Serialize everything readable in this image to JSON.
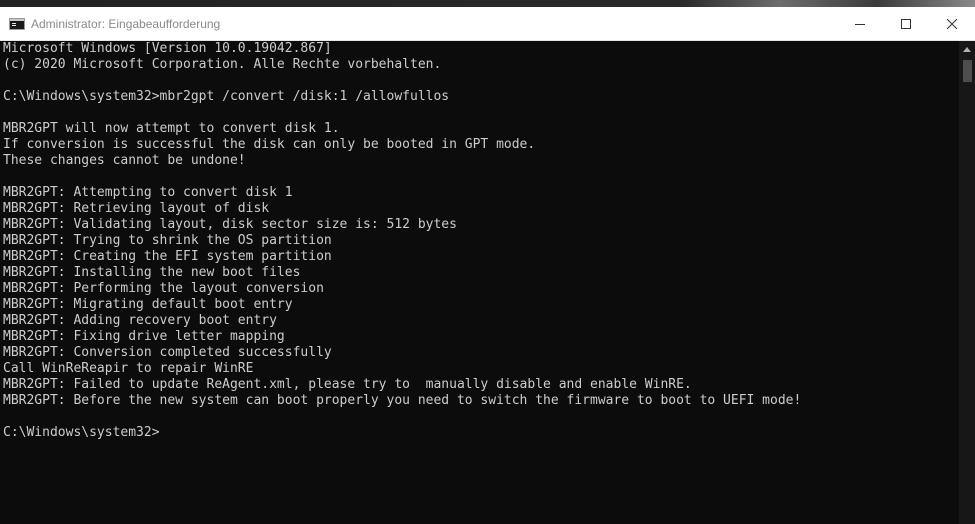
{
  "window": {
    "title": "Administrator: Eingabeaufforderung",
    "icon": "cmd-icon",
    "controls": [
      "minimize-icon",
      "maximize-icon",
      "close-icon"
    ]
  },
  "console": {
    "lines": [
      "Microsoft Windows [Version 10.0.19042.867]",
      "(c) 2020 Microsoft Corporation. Alle Rechte vorbehalten.",
      "",
      "C:\\Windows\\system32>mbr2gpt /convert /disk:1 /allowfullos",
      "",
      "MBR2GPT will now attempt to convert disk 1.",
      "If conversion is successful the disk can only be booted in GPT mode.",
      "These changes cannot be undone!",
      "",
      "MBR2GPT: Attempting to convert disk 1",
      "MBR2GPT: Retrieving layout of disk",
      "MBR2GPT: Validating layout, disk sector size is: 512 bytes",
      "MBR2GPT: Trying to shrink the OS partition",
      "MBR2GPT: Creating the EFI system partition",
      "MBR2GPT: Installing the new boot files",
      "MBR2GPT: Performing the layout conversion",
      "MBR2GPT: Migrating default boot entry",
      "MBR2GPT: Adding recovery boot entry",
      "MBR2GPT: Fixing drive letter mapping",
      "MBR2GPT: Conversion completed successfully",
      "Call WinReReapir to repair WinRE",
      "MBR2GPT: Failed to update ReAgent.xml, please try to  manually disable and enable WinRE.",
      "MBR2GPT: Before the new system can boot properly you need to switch the firmware to boot to UEFI mode!",
      "",
      "C:\\Windows\\system32>"
    ]
  },
  "colors": {
    "console_bg": "#0c0c0c",
    "console_text": "#cccccc",
    "titlebar_bg": "#ffffff",
    "title_text": "#8a8a8a"
  }
}
